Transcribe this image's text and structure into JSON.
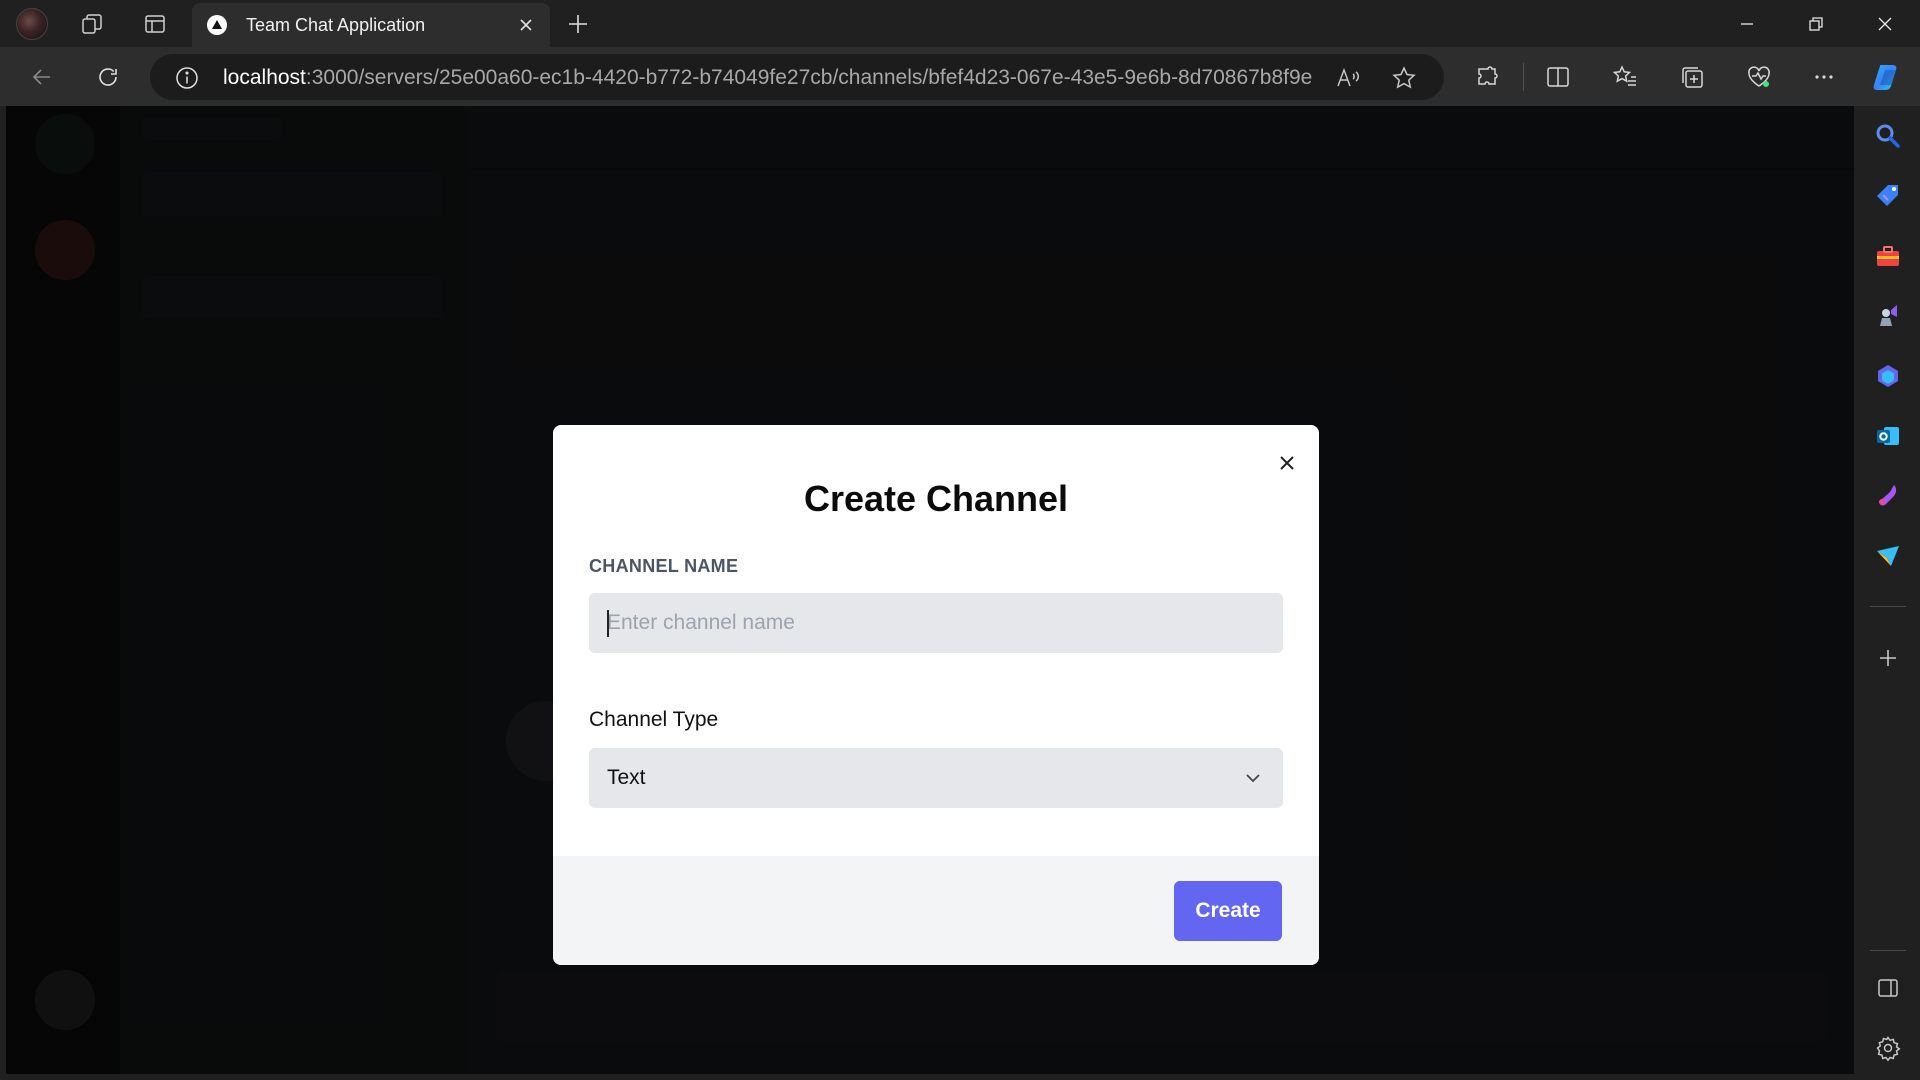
{
  "browser": {
    "tab_title": "Team Chat Application",
    "address_host": "localhost",
    "address_rest": ":3000/servers/25e00a60-ec1b-4420-b772-b74049fe27cb/channels/bfef4d23-067e-43e5-9e6b-8d70867b8f9e"
  },
  "modal": {
    "title": "Create Channel",
    "name_label": "CHANNEL NAME",
    "name_placeholder": "Enter channel name",
    "name_value": "",
    "type_label": "Channel Type",
    "type_value": "Text",
    "create_label": "Create"
  },
  "colors": {
    "accent": "#6366f1",
    "modal_bg": "#ffffff",
    "footer_bg": "#f3f4f6",
    "input_bg": "#e5e7eb"
  },
  "icons": {
    "close": "close-icon",
    "select": "chevron-down-icon"
  }
}
